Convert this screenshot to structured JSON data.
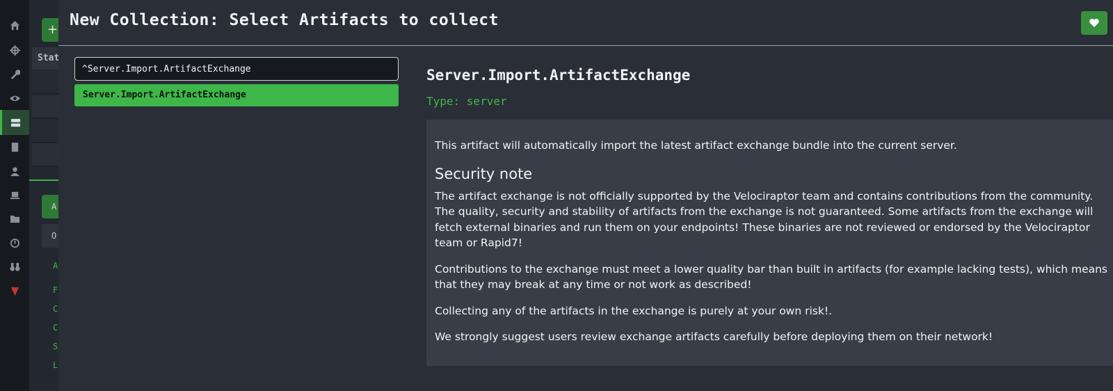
{
  "background": {
    "add_label": "+",
    "table_header": "Stat",
    "tab_active": "A",
    "tab_inactive": "O",
    "letters": [
      "A",
      "F",
      "C",
      "C",
      "S",
      "L"
    ]
  },
  "modal": {
    "title": "New Collection: Select Artifacts to collect",
    "favorite_icon": "heart-icon"
  },
  "search": {
    "value": "^Server.Import.ArtifactExchange"
  },
  "results": [
    {
      "label": "Server.Import.ArtifactExchange",
      "selected": true
    }
  ],
  "detail": {
    "name": "Server.Import.ArtifactExchange",
    "type": "Type: server",
    "intro": "This artifact will automatically import the latest artifact exchange bundle into the current server.",
    "heading": "Security note",
    "para1": "The artifact exchange is not officially supported by the Velociraptor team and contains contributions from the community. The quality, security and stability of artifacts from the exchange is not guaranteed. Some artifacts from the exchange will fetch external binaries and run them on your endpoints! These binaries are not reviewed or endorsed by the Velociraptor team or Rapid7!",
    "para2": "Contributions to the exchange must meet a lower quality bar than built in artifacts (for example lacking tests), which means that they may break at any time or not work as described!",
    "para3": "Collecting any of the artifacts in the exchange is purely at your own risk!.",
    "para4": "We strongly suggest users review exchange artifacts carefully before deploying them on their network!"
  },
  "colors": {
    "accent": "#3db749",
    "modal_bg": "#2a2e36",
    "desc_bg": "#383d48"
  }
}
